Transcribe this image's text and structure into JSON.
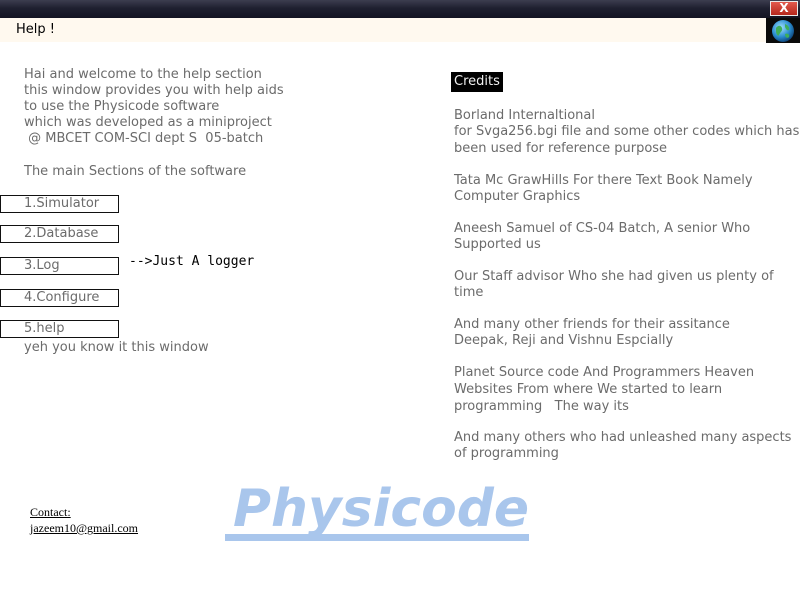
{
  "window": {
    "close_label": "X"
  },
  "header": {
    "title": "Help !"
  },
  "icons": {
    "globe": "globe-icon",
    "close": "close-icon"
  },
  "intro": {
    "lines": [
      "Hai and welcome to the help section",
      "this window provides you with help aids",
      "to use the Physicode software",
      "which was developed as a miniproject",
      " @ MBCET COM-SCI dept S  05-batch"
    ],
    "sections_heading": "The main Sections of the software"
  },
  "sections": [
    {
      "label": "1.Simulator"
    },
    {
      "label": "2.Database"
    },
    {
      "label": "3.Log"
    },
    {
      "label": "4.Configure"
    },
    {
      "label": "5.help"
    }
  ],
  "log_note": "-->Just A logger",
  "help_note": "yeh you know it this window",
  "credits": {
    "title": "Credits",
    "lines": [
      "Borland Internaltional",
      "for Svga256.bgi file and some other codes which has",
      "been used for reference purpose",
      "Tata Mc GrawHills For there Text Book Namely",
      "Computer Graphics",
      "Aneesh Samuel of CS-04 Batch, A senior Who",
      "Supported us",
      "Our Staff advisor Who she had given us plenty of",
      "time",
      "And many other friends for their assitance",
      "Deepak, Reji and Vishnu Espcially",
      "Planet Source code And Programmers Heaven",
      "Websites From where We started to learn",
      "programming   The way its",
      "And many others who had unleashed many aspects",
      "of programming"
    ]
  },
  "contact": {
    "label": "Contact:",
    "email": "jazeem10@gmail.com"
  },
  "logo": {
    "text": "Physicode",
    "color": "#a9c6ec"
  },
  "colors": {
    "titlebar": "#1f2030",
    "header_bg": "#fff9ef",
    "close_red": "#c8372b",
    "text": "#6b6b6b"
  }
}
